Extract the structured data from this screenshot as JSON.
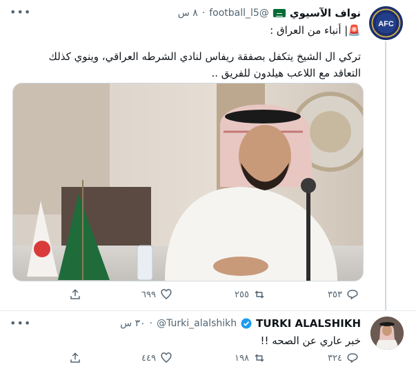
{
  "tweet1": {
    "name": "نواف الآسيوي",
    "handle": "@football_l5",
    "time": "٨ س",
    "flag_icon": "saudi-flag-icon",
    "subtitle": "🚨| أنباء من العراق :",
    "text": "تركي ال الشيخ يتكفل بصفقة ريفاس لنادي الشرطه العراقي، وينوي كذلك التعاقد مع اللاعب هيلدون للفريق ..",
    "avatar_text": "AFC",
    "actions": {
      "reply_count": "٣٥٣",
      "retweet_count": "٢٥٥",
      "like_count": "٦٩٩"
    }
  },
  "tweet2": {
    "name": "TURKI ALALSHIKH",
    "handle": "@Turki_alalshikh",
    "time": "٣٠ س",
    "verified_icon": "verified-badge-icon",
    "text": "خبر عاري عن الصحه !!",
    "actions": {
      "reply_count": "٣٢٤",
      "retweet_count": "١٩٨",
      "like_count": "٤٤٩"
    }
  },
  "colors": {
    "text": "#0f1419",
    "muted": "#536471",
    "divider": "#e6ecf0",
    "verified": "#1d9bf0"
  }
}
